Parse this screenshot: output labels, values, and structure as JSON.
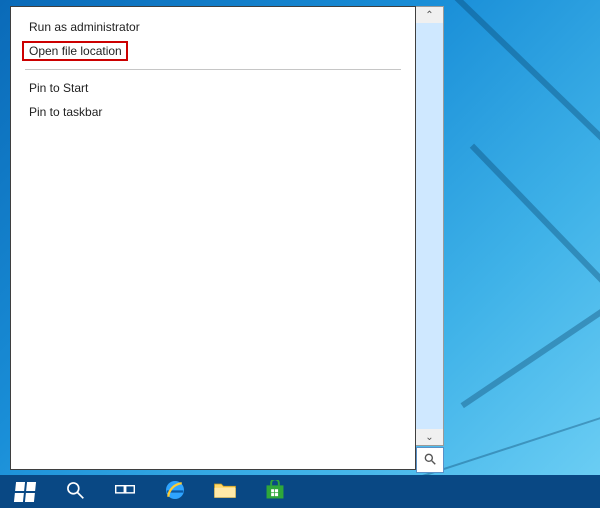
{
  "context_menu": {
    "items": [
      {
        "label": "Run as administrator"
      },
      {
        "label": "Open file location",
        "highlighted": true
      },
      {
        "separator": true
      },
      {
        "label": "Pin to Start"
      },
      {
        "label": "Pin to taskbar"
      }
    ]
  },
  "scroll": {
    "up_glyph": "⌃",
    "down_glyph": "⌄"
  },
  "taskbar": {
    "start": "start-button",
    "search": "search-button",
    "taskview": "task-view-button",
    "ie": "internet-explorer",
    "explorer": "file-explorer",
    "store": "windows-store"
  }
}
